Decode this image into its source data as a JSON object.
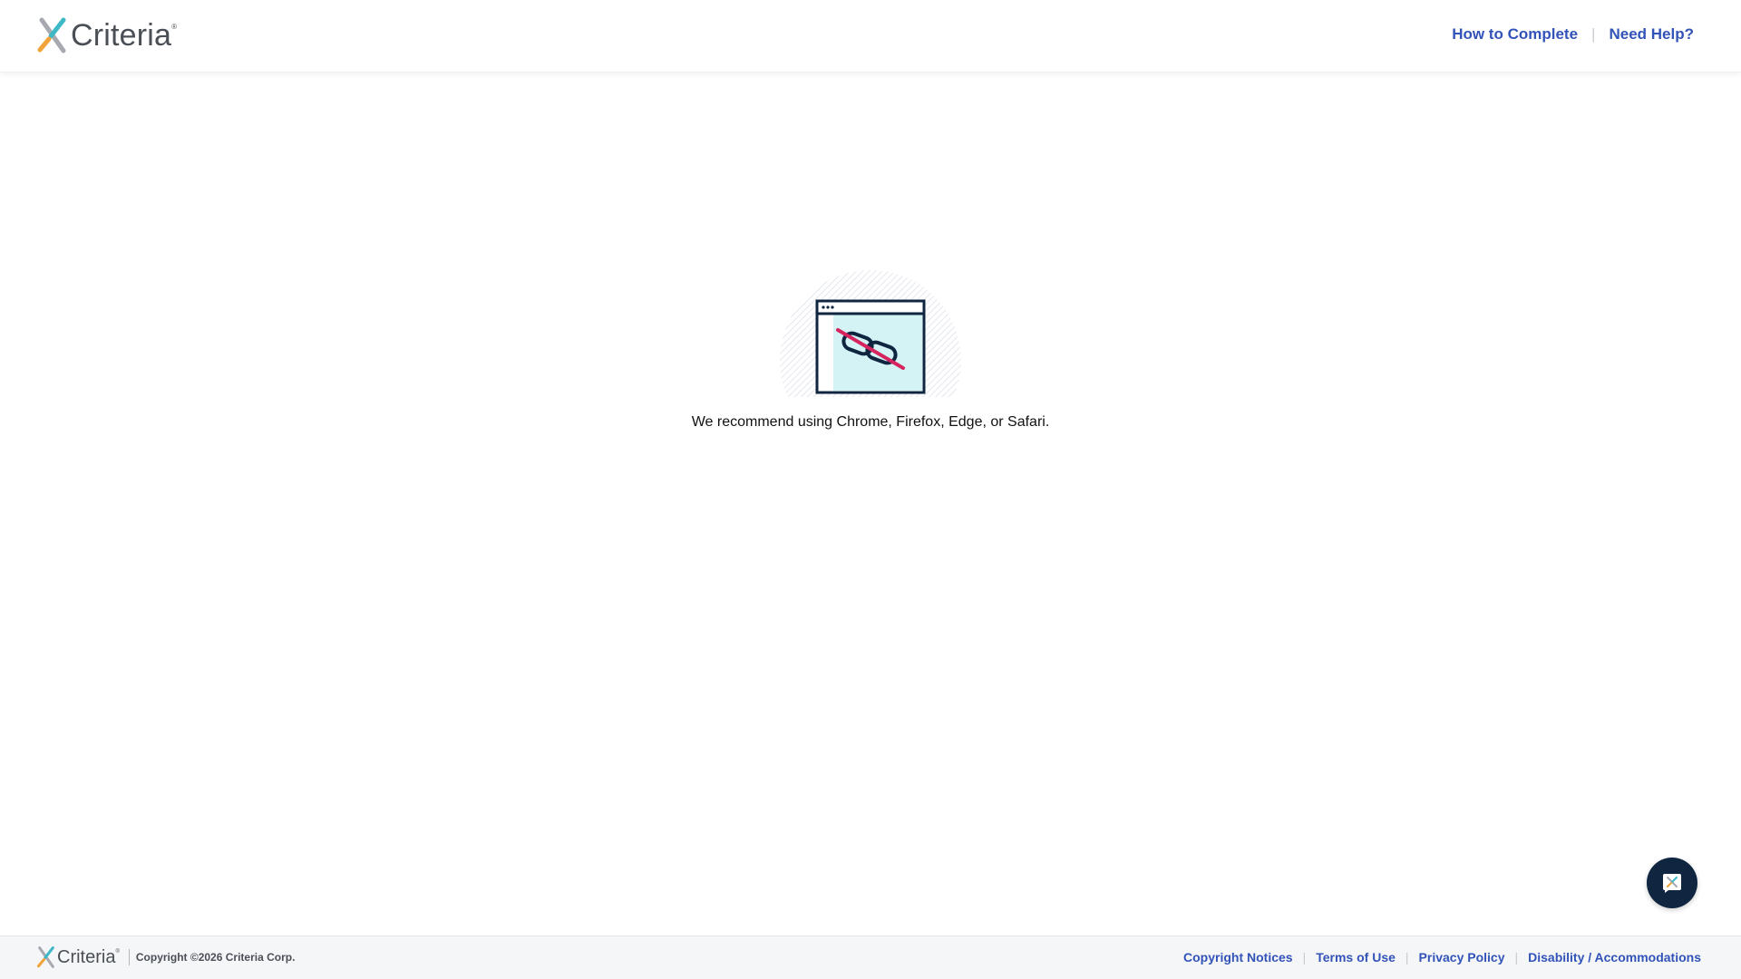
{
  "brand": {
    "name": "Criteria",
    "registered_mark": "®",
    "colors": {
      "teal": "#3fb8c6",
      "orange": "#f2a33a",
      "gray": "#a6aab0",
      "text": "#4a4f56",
      "link": "#3253b8",
      "navy": "#0f2540",
      "crimson": "#d6245f"
    }
  },
  "header": {
    "nav": [
      {
        "label": "How to Complete"
      },
      {
        "label": "Need Help?"
      }
    ],
    "separator": "|"
  },
  "main": {
    "illustration_icon": "broken-link-browser-icon",
    "message": "We recommend using Chrome, Firefox, Edge, or Safari."
  },
  "chat": {
    "icon": "chat-icon"
  },
  "footer": {
    "copyright": "Copyright ©2026 Criteria Corp.",
    "links": [
      {
        "label": "Copyright Notices"
      },
      {
        "label": "Terms of Use"
      },
      {
        "label": "Privacy Policy"
      },
      {
        "label": "Disability / Accommodations"
      }
    ],
    "separator": "|"
  }
}
